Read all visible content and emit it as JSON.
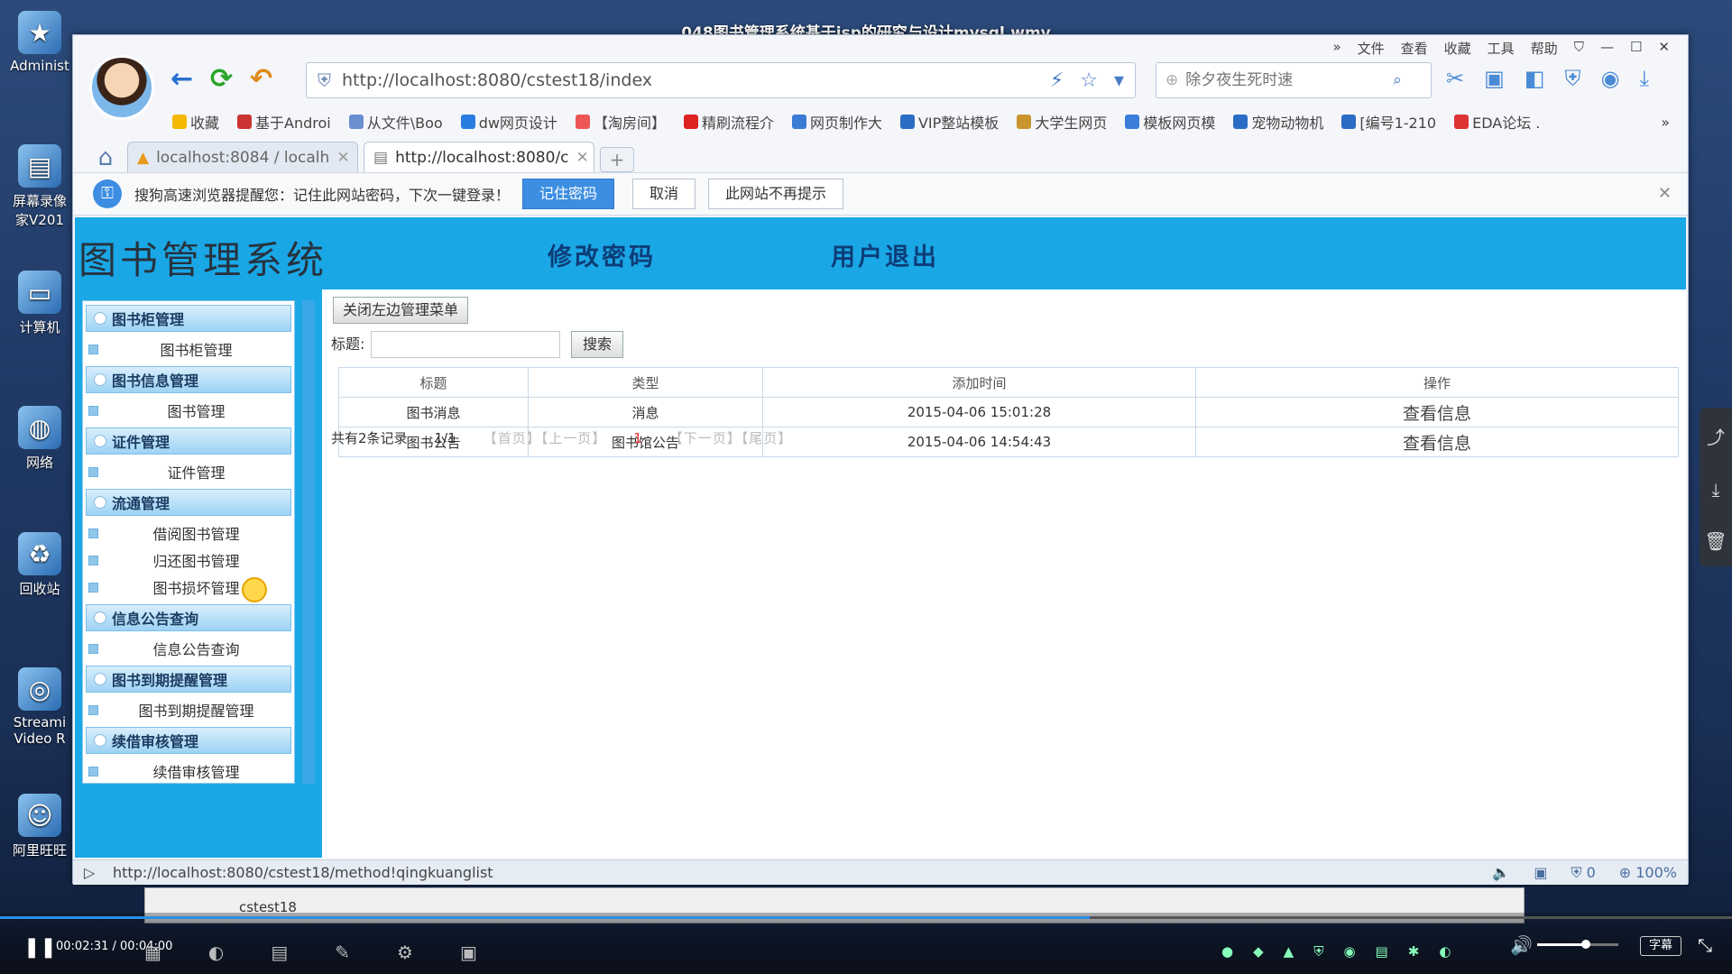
{
  "video": {
    "title": "048图书管理系统基于jsp的研究与设计mysql.wmv",
    "time": "00:02:31 / 00:04:00",
    "progress": 0.629,
    "volume": 0.6,
    "subtitle_label": "字幕"
  },
  "desktop": {
    "icons": [
      "Administ",
      "屏幕录像 家V201",
      "计算机",
      "网络",
      "回收站",
      "Streami Video R",
      "阿里旺旺"
    ]
  },
  "browser": {
    "menu": [
      "»",
      "文件",
      "查看",
      "收藏",
      "工具",
      "帮助"
    ],
    "url": "http://localhost:8080/cstest18/index",
    "search_placeholder": "除夕夜生死时速",
    "bookmarks": [
      {
        "label": "收藏",
        "color": "#f5b800"
      },
      {
        "label": "基于Androi",
        "color": "#c33"
      },
      {
        "label": "从文件\\Boo",
        "color": "#6a8fd0"
      },
      {
        "label": "dw网页设计",
        "color": "#2a7de0"
      },
      {
        "label": "【淘房间】",
        "color": "#e55"
      },
      {
        "label": "精刷流程介",
        "color": "#d22"
      },
      {
        "label": "网页制作大",
        "color": "#3a7bd5"
      },
      {
        "label": "VIP整站模板",
        "color": "#2b6cc4"
      },
      {
        "label": "大学生网页",
        "color": "#c9942c"
      },
      {
        "label": "模板网页模",
        "color": "#3b7dd8"
      },
      {
        "label": "宠物动物机",
        "color": "#2b6cc4"
      },
      {
        "label": "[编号1-210",
        "color": "#2b6cc4"
      },
      {
        "label": "EDA论坛 .",
        "color": "#d33"
      }
    ],
    "tabs": [
      {
        "label": "localhost:8084 / localh"
      },
      {
        "label": "http://localhost:8080/c"
      }
    ],
    "password_bar": {
      "message": "搜狗高速浏览器提醒您：记住此网站密码，下次一键登录！",
      "remember": "记住密码",
      "cancel": "取消",
      "never": "此网站不再提示"
    },
    "status_url": "http://localhost:8080/cstest18/method!qingkuanglist",
    "status_count": "0",
    "zoom": "100%"
  },
  "page": {
    "title": "图书管理系统",
    "nav": {
      "change_password": "修改密码",
      "logout": "用户退出"
    },
    "toggle_menu": "关闭左边管理菜单",
    "search_label": "标题:",
    "search_button": "搜索",
    "sidebar": [
      {
        "group": "图书柜管理",
        "items": [
          "图书柜管理"
        ]
      },
      {
        "group": "图书信息管理",
        "items": [
          "图书管理"
        ]
      },
      {
        "group": "证件管理",
        "items": [
          "证件管理"
        ]
      },
      {
        "group": "流通管理",
        "items": [
          "借阅图书管理",
          "归还图书管理",
          "图书损坏管理"
        ]
      },
      {
        "group": "信息公告查询",
        "items": [
          "信息公告查询"
        ]
      },
      {
        "group": "图书到期提醒管理",
        "items": [
          "图书到期提醒管理"
        ]
      },
      {
        "group": "续借审核管理",
        "items": [
          "续借审核管理"
        ]
      }
    ],
    "table": {
      "headers": [
        "标题",
        "类型",
        "添加时间",
        "操作"
      ],
      "rows": [
        [
          "图书消息",
          "消息",
          "2015-04-06 15:01:28",
          "查看信息"
        ],
        [
          "图书公告",
          "图书馆公告",
          "2015-04-06 14:54:43",
          "查看信息"
        ]
      ]
    },
    "pager": {
      "total": "共有2条记录",
      "pages": "1/1",
      "first_prev": "【首页】【上一页】",
      "current": "1",
      "next_last": "【下一页】【尾页】"
    }
  },
  "lower_window": {
    "label": "cstest18"
  }
}
